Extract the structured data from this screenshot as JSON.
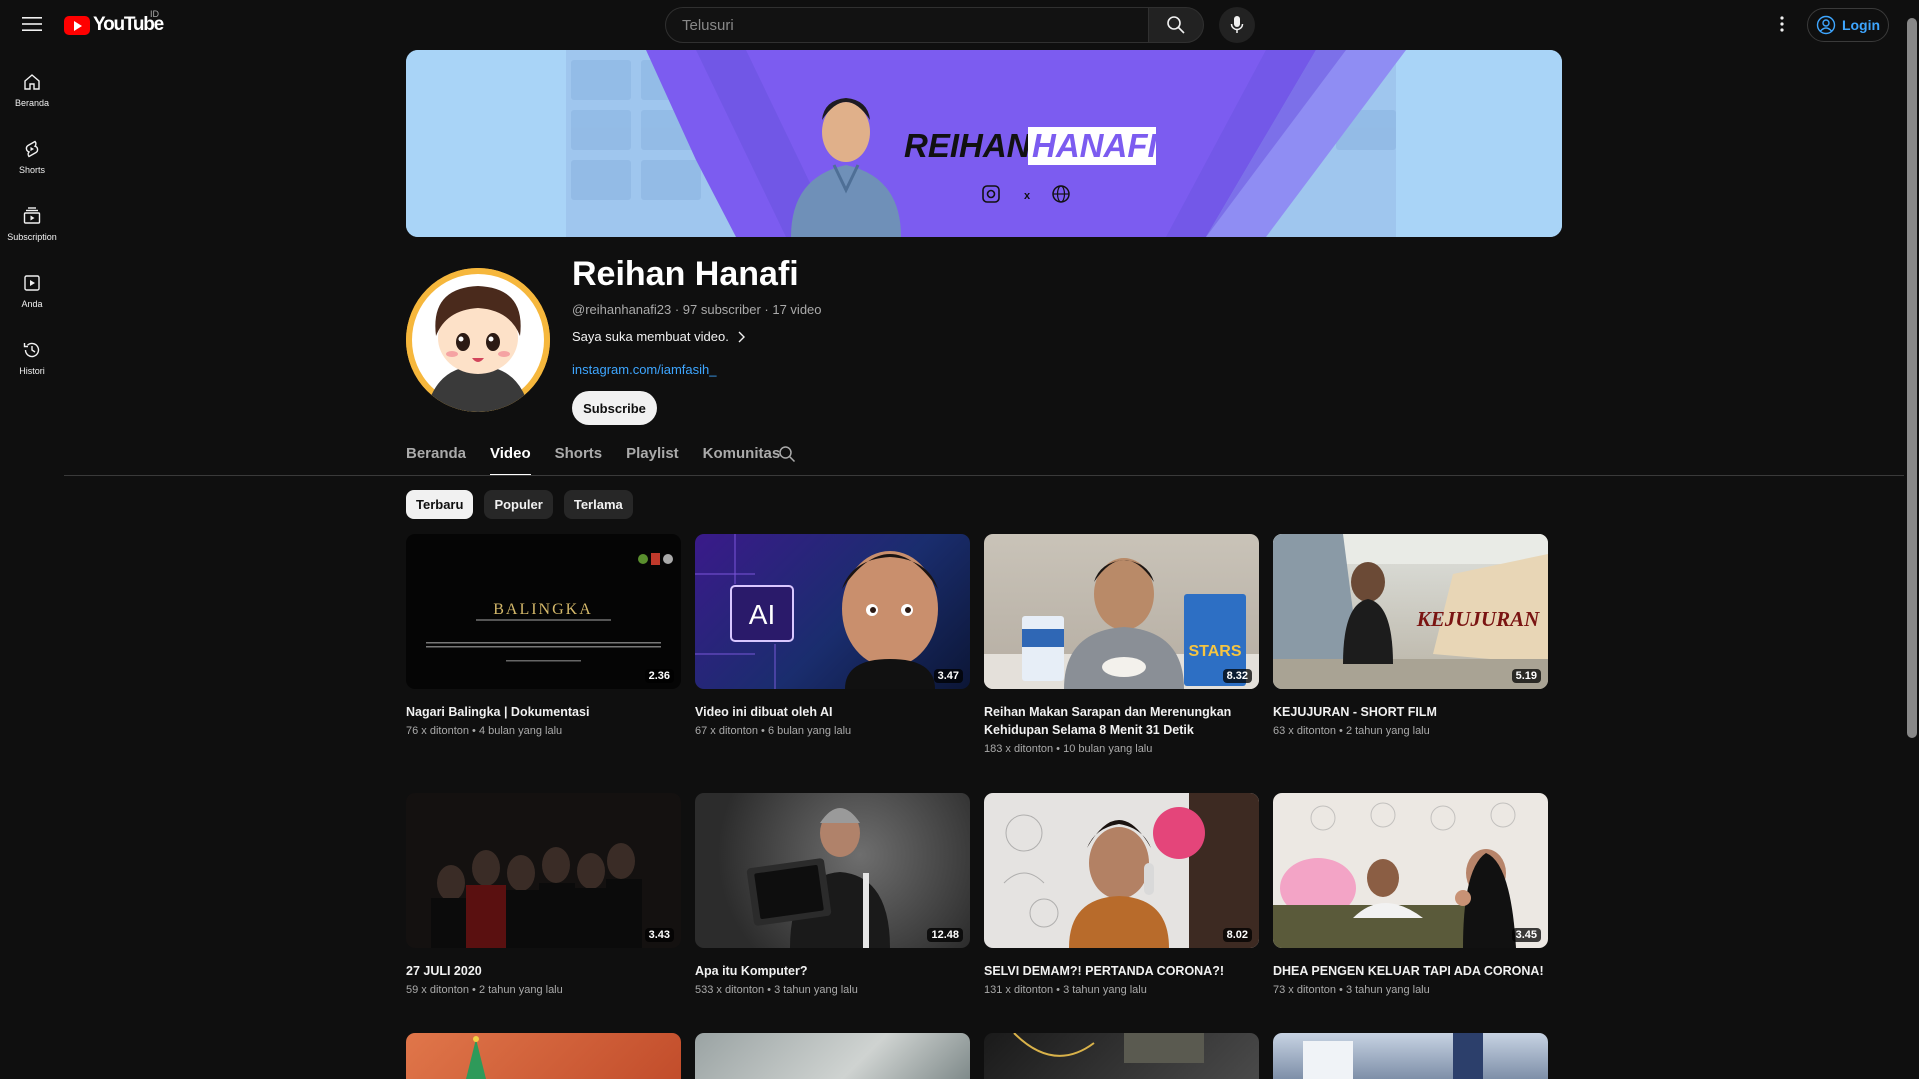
{
  "app": {
    "logo_text": "YouTube",
    "country_code": "ID"
  },
  "topbar": {
    "search_placeholder": "Telusuri",
    "login_label": "Login"
  },
  "rail": [
    {
      "label": "Beranda",
      "icon": "home-icon"
    },
    {
      "label": "Shorts",
      "icon": "shorts-icon"
    },
    {
      "label": "Subscription",
      "icon": "subscriptions-icon"
    },
    {
      "label": "Anda",
      "icon": "you-icon"
    },
    {
      "label": "Histori",
      "icon": "history-icon"
    }
  ],
  "banner": {
    "name_part1": "REIHAN",
    "name_part2": "HANAFI",
    "x_label": "x",
    "colors": {
      "bg": "#a9d4f7",
      "accent": "#7c5cf0"
    }
  },
  "channel": {
    "name": "Reihan Hanafi",
    "meta": "@reihanhanafi23 · 97 subscriber · 17 video",
    "description": "Saya suka membuat video.",
    "link": "instagram.com/iamfasih_",
    "subscribe_label": "Subscribe"
  },
  "tabs": [
    {
      "label": "Beranda",
      "active": false
    },
    {
      "label": "Video",
      "active": true
    },
    {
      "label": "Shorts",
      "active": false
    },
    {
      "label": "Playlist",
      "active": false
    },
    {
      "label": "Komunitas",
      "active": false
    }
  ],
  "chips": [
    {
      "label": "Terbaru",
      "active": true
    },
    {
      "label": "Populer",
      "active": false
    },
    {
      "label": "Terlama",
      "active": false
    }
  ],
  "videos": [
    {
      "title": "Nagari Balingka | Dokumentasi",
      "title2": "",
      "meta": "76 x ditonton • 4 bulan yang lalu",
      "duration": "2.36",
      "thumb_text": "BALINGKA"
    },
    {
      "title": "Video ini dibuat oleh AI",
      "title2": "",
      "meta": "67 x ditonton • 6 bulan yang lalu",
      "duration": "3.47",
      "thumb_text": "AI"
    },
    {
      "title": "Reihan Makan Sarapan dan Merenungkan",
      "title2": "Kehidupan Selama 8 Menit 31 Detik",
      "meta": "183 x ditonton • 10 bulan yang lalu",
      "duration": "8.32",
      "thumb_text": "STARS"
    },
    {
      "title": "KEJUJURAN - SHORT FILM",
      "title2": "",
      "meta": "63 x ditonton • 2 tahun yang lalu",
      "duration": "5.19",
      "thumb_text": "KEJUJURAN"
    },
    {
      "title": "27 JULI 2020",
      "title2": "",
      "meta": "59 x ditonton • 2 tahun yang lalu",
      "duration": "3.43",
      "thumb_text": ""
    },
    {
      "title": "Apa itu Komputer?",
      "title2": "",
      "meta": "533 x ditonton • 3 tahun yang lalu",
      "duration": "12.48",
      "thumb_text": ""
    },
    {
      "title": "SELVI DEMAM?! PERTANDA CORONA?!",
      "title2": "",
      "meta": "131 x ditonton • 3 tahun yang lalu",
      "duration": "8.02",
      "thumb_text": ""
    },
    {
      "title": "DHEA PENGEN KELUAR TAPI ADA CORONA!",
      "title2": "",
      "meta": "73 x ditonton • 3 tahun yang lalu",
      "duration": "3.45",
      "thumb_text": ""
    }
  ]
}
